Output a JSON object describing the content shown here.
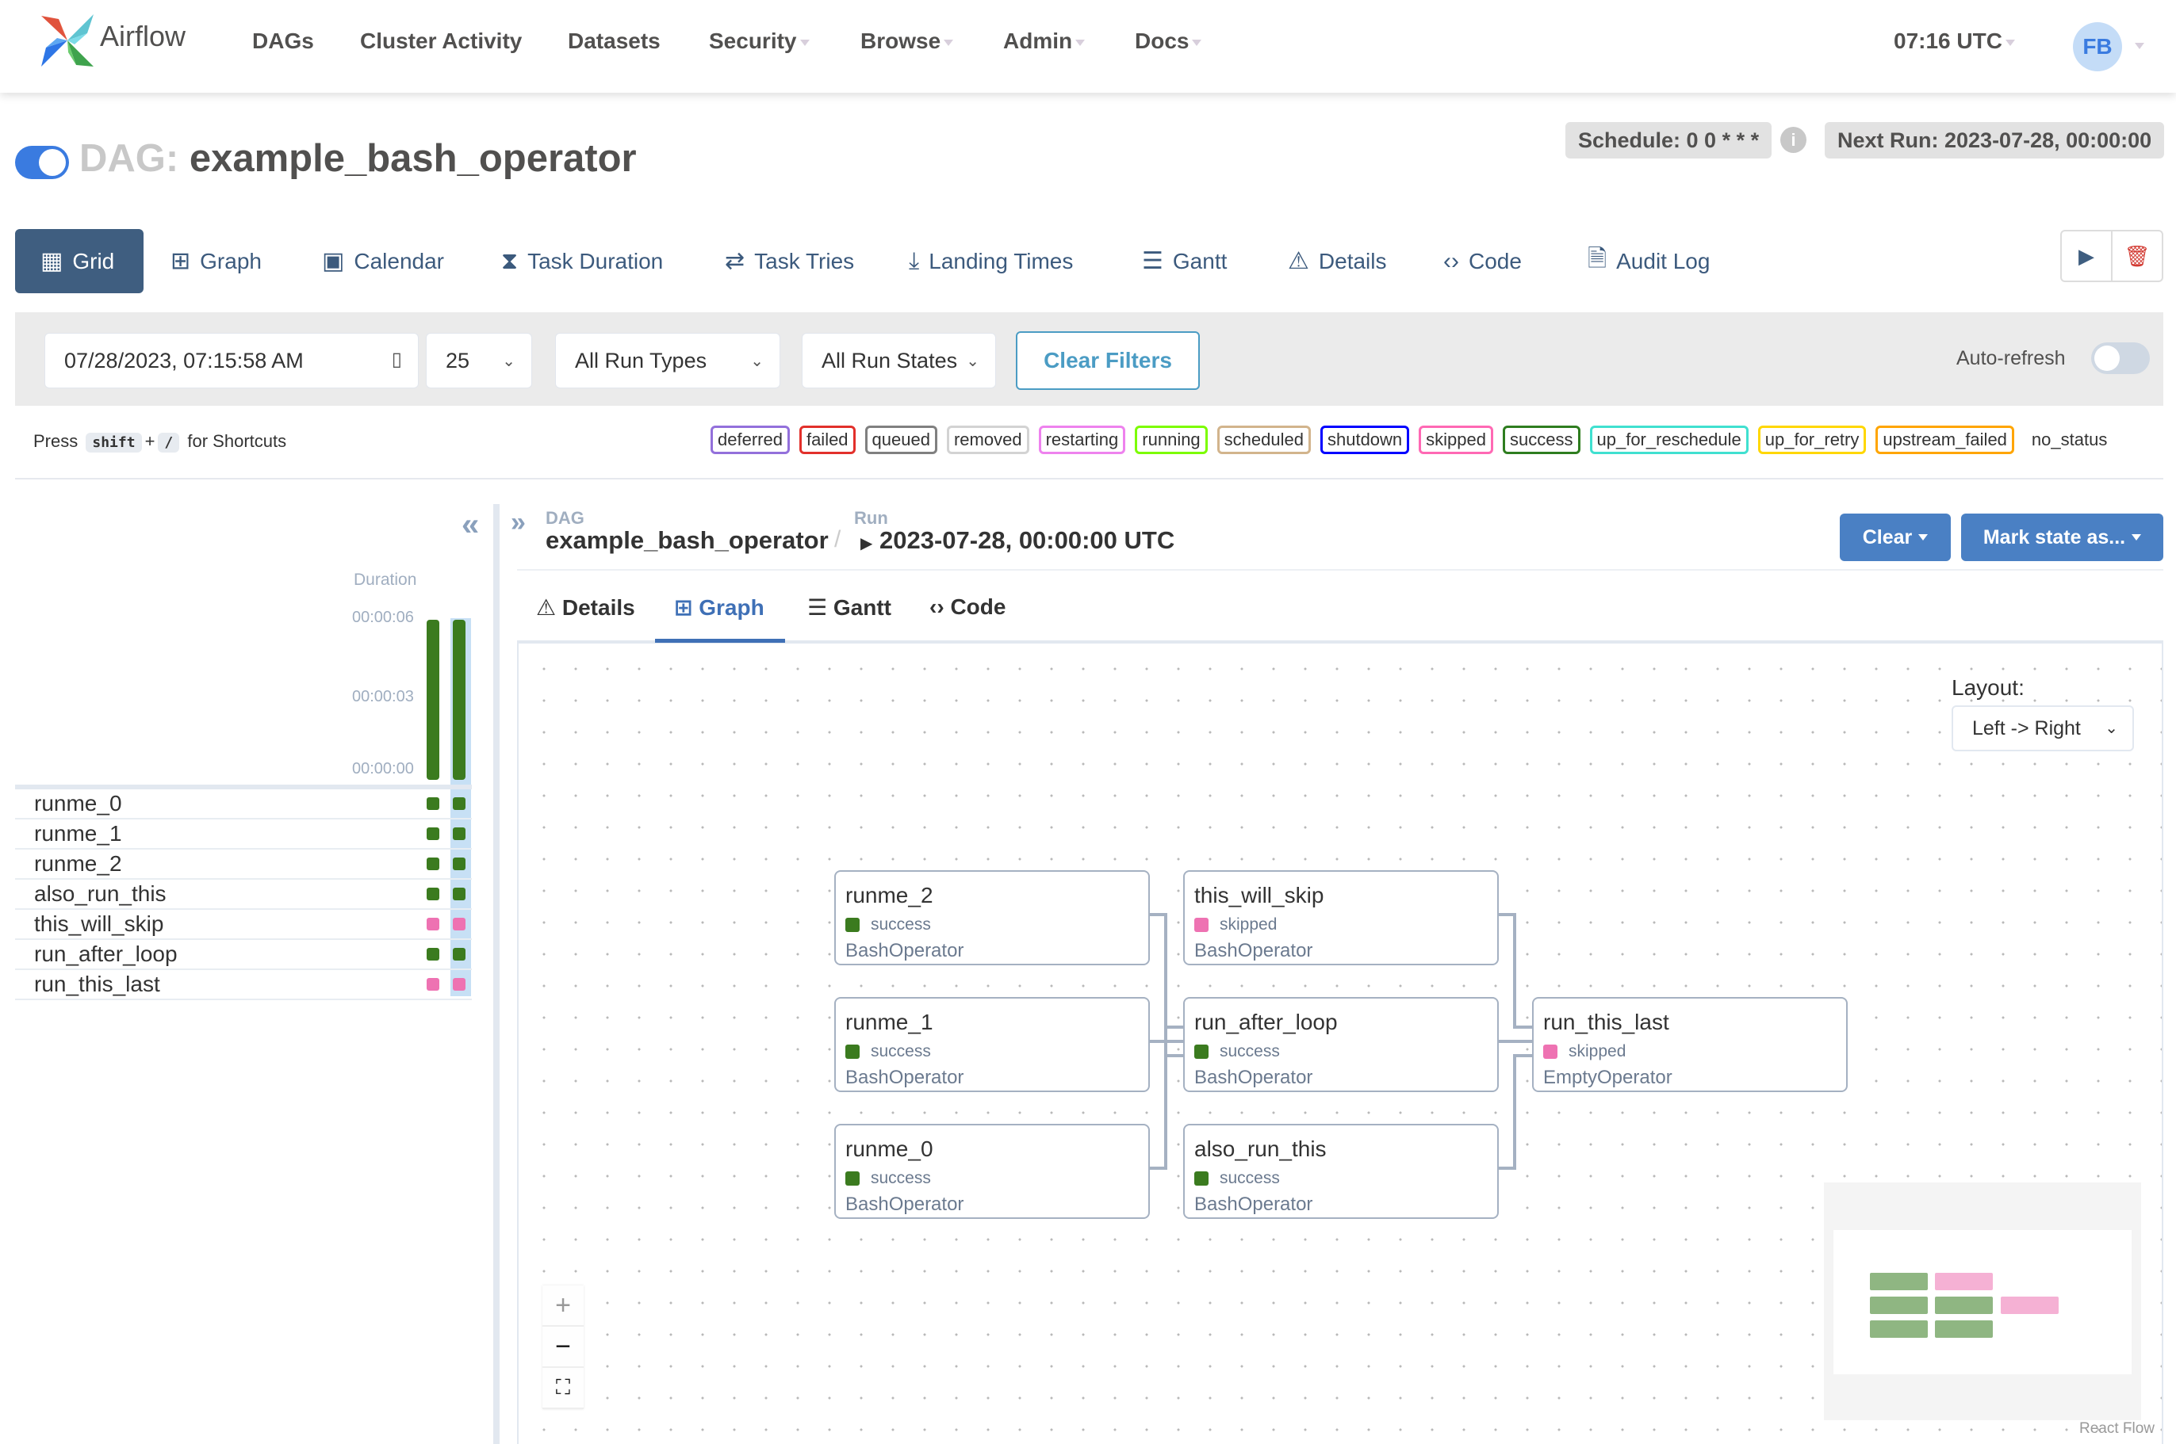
{
  "app": {
    "name": "Airflow"
  },
  "nav": {
    "items": [
      {
        "label": "DAGs",
        "dropdown": false
      },
      {
        "label": "Cluster Activity",
        "dropdown": false
      },
      {
        "label": "Datasets",
        "dropdown": false
      },
      {
        "label": "Security",
        "dropdown": true
      },
      {
        "label": "Browse",
        "dropdown": true
      },
      {
        "label": "Admin",
        "dropdown": true
      },
      {
        "label": "Docs",
        "dropdown": true
      }
    ],
    "time": "07:16 UTC",
    "user_initials": "FB"
  },
  "dag_header": {
    "prefix": "DAG:",
    "dag_id": "example_bash_operator",
    "paused": false,
    "schedule": "Schedule: 0 0 * * *",
    "info_icon": "i",
    "next_run": "Next Run: 2023-07-28, 00:00:00"
  },
  "view_tabs": [
    {
      "label": "Grid",
      "icon": "grid-icon",
      "active": true
    },
    {
      "label": "Graph",
      "icon": "graph-icon"
    },
    {
      "label": "Calendar",
      "icon": "calendar-icon"
    },
    {
      "label": "Task Duration",
      "icon": "hourglass-icon"
    },
    {
      "label": "Task Tries",
      "icon": "repeat-icon"
    },
    {
      "label": "Landing Times",
      "icon": "landing-icon"
    },
    {
      "label": "Gantt",
      "icon": "gantt-icon"
    },
    {
      "label": "Details",
      "icon": "warning-triangle-icon"
    },
    {
      "label": "Code",
      "icon": "code-icon"
    },
    {
      "label": "Audit Log",
      "icon": "document-search-icon"
    }
  ],
  "view_actions": {
    "trigger": "▶",
    "delete": "🗑"
  },
  "filters": {
    "base_date": "07/28/2023, 07:15:58 AM",
    "num_runs": "25",
    "run_type": "All Run Types",
    "run_state": "All Run States",
    "clear_label": "Clear Filters",
    "auto_refresh_label": "Auto-refresh",
    "auto_refresh_on": false
  },
  "shortcuts": {
    "press": "Press",
    "key1": "shift",
    "plus": "+",
    "key2": "/",
    "suffix": "for Shortcuts"
  },
  "states_legend": [
    {
      "label": "deferred",
      "color": "#9370db"
    },
    {
      "label": "failed",
      "color": "#e2302b"
    },
    {
      "label": "queued",
      "color": "#808080"
    },
    {
      "label": "removed",
      "color": "#d3d3d3"
    },
    {
      "label": "restarting",
      "color": "#ee82ee"
    },
    {
      "label": "running",
      "color": "#7cfc00"
    },
    {
      "label": "scheduled",
      "color": "#d2b48c"
    },
    {
      "label": "shutdown",
      "color": "#0000ff"
    },
    {
      "label": "skipped",
      "color": "#ff69b4"
    },
    {
      "label": "success",
      "color": "#2e7d1f"
    },
    {
      "label": "up_for_reschedule",
      "color": "#40e0d0"
    },
    {
      "label": "up_for_retry",
      "color": "#ffd700"
    },
    {
      "label": "upstream_failed",
      "color": "#ffa500"
    }
  ],
  "no_status_label": "no_status",
  "grid": {
    "collapse_icon": "«",
    "duration_label": "Duration",
    "ticks": [
      "00:00:06",
      "00:00:03",
      "00:00:00"
    ],
    "runs": [
      {
        "duration_fraction": 1.0,
        "state": "success",
        "selected": false
      },
      {
        "duration_fraction": 1.0,
        "state": "success",
        "selected": true
      }
    ],
    "tasks": [
      {
        "name": "runme_0",
        "states": [
          "success",
          "success"
        ]
      },
      {
        "name": "runme_1",
        "states": [
          "success",
          "success"
        ]
      },
      {
        "name": "runme_2",
        "states": [
          "success",
          "success"
        ]
      },
      {
        "name": "also_run_this",
        "states": [
          "success",
          "success"
        ]
      },
      {
        "name": "this_will_skip",
        "states": [
          "skipped",
          "skipped"
        ]
      },
      {
        "name": "run_after_loop",
        "states": [
          "success",
          "success"
        ]
      },
      {
        "name": "run_this_last",
        "states": [
          "skipped",
          "skipped"
        ]
      }
    ]
  },
  "details": {
    "expand_icon": "»",
    "dag_label": "DAG",
    "dag_value": "example_bash_operator",
    "separator": "/",
    "run_label": "Run",
    "run_value": "2023-07-28, 00:00:00 UTC",
    "clear_button": "Clear",
    "mark_state_button": "Mark state as...",
    "tabs": [
      {
        "label": "Details",
        "icon": "⚠",
        "active": false
      },
      {
        "label": "Graph",
        "icon": "⊞",
        "active": true
      },
      {
        "label": "Gantt",
        "icon": "☰",
        "active": false
      },
      {
        "label": "Code",
        "icon": "‹›",
        "active": false
      }
    ]
  },
  "graph": {
    "layout_label": "Layout:",
    "layout_value": "Left -> Right",
    "nodes": [
      {
        "id": "runme_2",
        "state": "success",
        "operator": "BashOperator"
      },
      {
        "id": "runme_1",
        "state": "success",
        "operator": "BashOperator"
      },
      {
        "id": "runme_0",
        "state": "success",
        "operator": "BashOperator"
      },
      {
        "id": "this_will_skip",
        "state": "skipped",
        "operator": "BashOperator"
      },
      {
        "id": "run_after_loop",
        "state": "success",
        "operator": "BashOperator"
      },
      {
        "id": "also_run_this",
        "state": "success",
        "operator": "BashOperator"
      },
      {
        "id": "run_this_last",
        "state": "skipped",
        "operator": "EmptyOperator"
      }
    ],
    "edges": [
      [
        "runme_0",
        "run_after_loop"
      ],
      [
        "runme_1",
        "run_after_loop"
      ],
      [
        "runme_2",
        "run_after_loop"
      ],
      [
        "this_will_skip",
        "run_this_last"
      ],
      [
        "run_after_loop",
        "run_this_last"
      ],
      [
        "also_run_this",
        "run_this_last"
      ]
    ],
    "zoom_controls": {
      "zoom_in": "+",
      "zoom_out": "−",
      "fit": "⛶"
    },
    "attribution": "React Flow"
  },
  "state_colors": {
    "success": "#3b7b1f",
    "skipped": "#ee72b2"
  }
}
